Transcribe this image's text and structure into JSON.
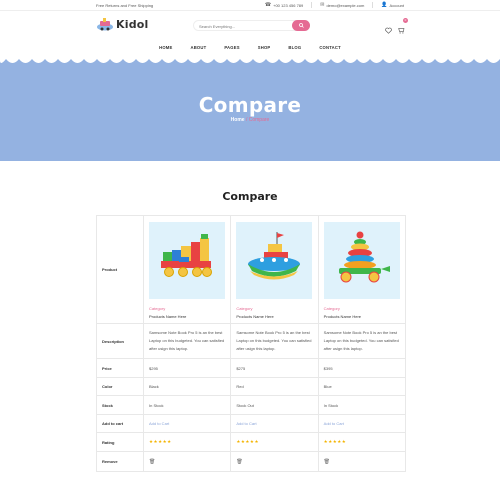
{
  "topbar": {
    "promo": "Free Returns and Free Shipping",
    "phone": "+00 123 456 789",
    "email": "demo@example.com",
    "account": "Account"
  },
  "header": {
    "logo_text": "Kidol",
    "search_placeholder": "Search Everything...",
    "cart_count": "0"
  },
  "nav": [
    "HOME",
    "ABOUT",
    "PAGES",
    "SHOP",
    "BLOG",
    "CONTACT"
  ],
  "banner": {
    "title": "Compare",
    "breadcrumb_home": "Home",
    "breadcrumb_sep": " / ",
    "breadcrumb_current": "Compare"
  },
  "section_title": "Compare",
  "labels": {
    "product": "Product",
    "description": "Description",
    "price": "Price",
    "color": "Color",
    "stock": "Stock",
    "add_to_cart": "Add to cart",
    "rating": "Rating",
    "remove": "Remove"
  },
  "products": [
    {
      "category": "Category",
      "name": "Products Name Here",
      "description": "Samsome Note Book Pro 5 is an the best Laptop on this budgeted. You can satisfied after usign this laptop.",
      "price": "$295",
      "color": "Black",
      "stock": "In Stock",
      "cart": "Add to Cart",
      "rating": "★★★★★",
      "remove_icon": "trash-icon",
      "image": "toy-train"
    },
    {
      "category": "Category",
      "name": "Products Name Here",
      "description": "Samsome Note Book Pro 5 is an the best Laptop on this budgeted. You can satisfied after usign this laptop.",
      "price": "$275",
      "color": "Red",
      "stock": "Stock Out",
      "cart": "Add to Cart",
      "rating": "★★★★★",
      "remove_icon": "trash-icon",
      "image": "toy-boat"
    },
    {
      "category": "Category",
      "name": "Products Name Here",
      "description": "Samsome Note Book Pro 5 is an the best Laptop on this budgeted. You can satisfied after usign this laptop.",
      "price": "$395",
      "color": "Blue",
      "stock": "In Stock",
      "cart": "Add to Cart",
      "rating": "★★★★★",
      "remove_icon": "trash-icon",
      "image": "toy-stacker"
    }
  ],
  "colors": {
    "accent": "#e56a93",
    "banner": "#94b2e1",
    "image_bg": "#dff2fb",
    "star": "#f4b400",
    "link": "#8aa4d8"
  }
}
